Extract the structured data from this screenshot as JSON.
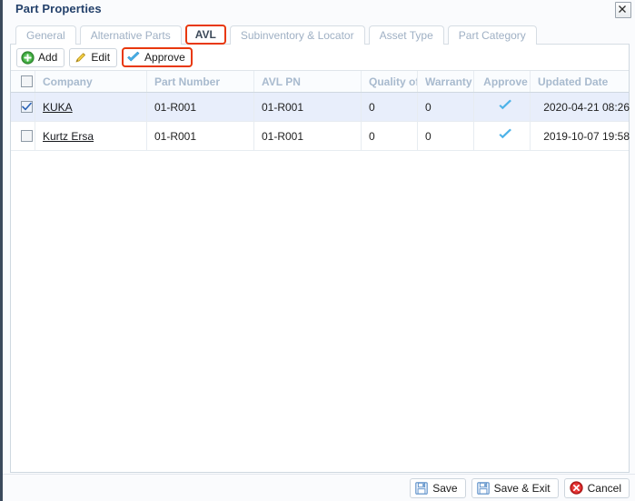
{
  "window": {
    "title": "Part Properties",
    "close_icon": "close-icon"
  },
  "tabs": [
    {
      "label": "General",
      "active": false
    },
    {
      "label": "Alternative Parts",
      "active": false
    },
    {
      "label": "AVL",
      "active": true
    },
    {
      "label": "Subinventory & Locator",
      "active": false
    },
    {
      "label": "Asset Type",
      "active": false
    },
    {
      "label": "Part Category",
      "active": false
    }
  ],
  "toolbar": {
    "add_label": "Add",
    "edit_label": "Edit",
    "approve_label": "Approve",
    "add_icon": "plus-circle-icon",
    "edit_icon": "pencil-icon",
    "approve_icon": "check-icon"
  },
  "grid": {
    "columns": [
      {
        "key": "select",
        "label": ""
      },
      {
        "key": "company",
        "label": "Company"
      },
      {
        "key": "part_number",
        "label": "Part Number"
      },
      {
        "key": "avl_pn",
        "label": "AVL PN"
      },
      {
        "key": "quality",
        "label": "Quality of"
      },
      {
        "key": "warranty",
        "label": "Warranty ("
      },
      {
        "key": "approve",
        "label": "Approve"
      },
      {
        "key": "updated_date",
        "label": "Updated Date"
      }
    ],
    "rows": [
      {
        "selected": true,
        "company": "KUKA",
        "part_number": "01-R001",
        "avl_pn": "01-R001",
        "quality": "0",
        "warranty": "0",
        "approve_icon": "check-icon",
        "updated_date": "2020-04-21 08:26"
      },
      {
        "selected": false,
        "company": "Kurtz Ersa",
        "part_number": "01-R001",
        "avl_pn": "01-R001",
        "quality": "0",
        "warranty": "0",
        "approve_icon": "check-icon",
        "updated_date": "2019-10-07 19:58"
      }
    ]
  },
  "footer": {
    "save_label": "Save",
    "save_exit_label": "Save & Exit",
    "cancel_label": "Cancel",
    "save_icon": "floppy-disk-icon",
    "cancel_icon": "error-circle-icon"
  },
  "colors": {
    "accent_highlight": "#e8380d",
    "header_text": "#a8bace",
    "title_text": "#24416b",
    "row_selected": "#e8eefb",
    "check_blue": "#4db2e8",
    "add_green": "#3ea93e"
  }
}
